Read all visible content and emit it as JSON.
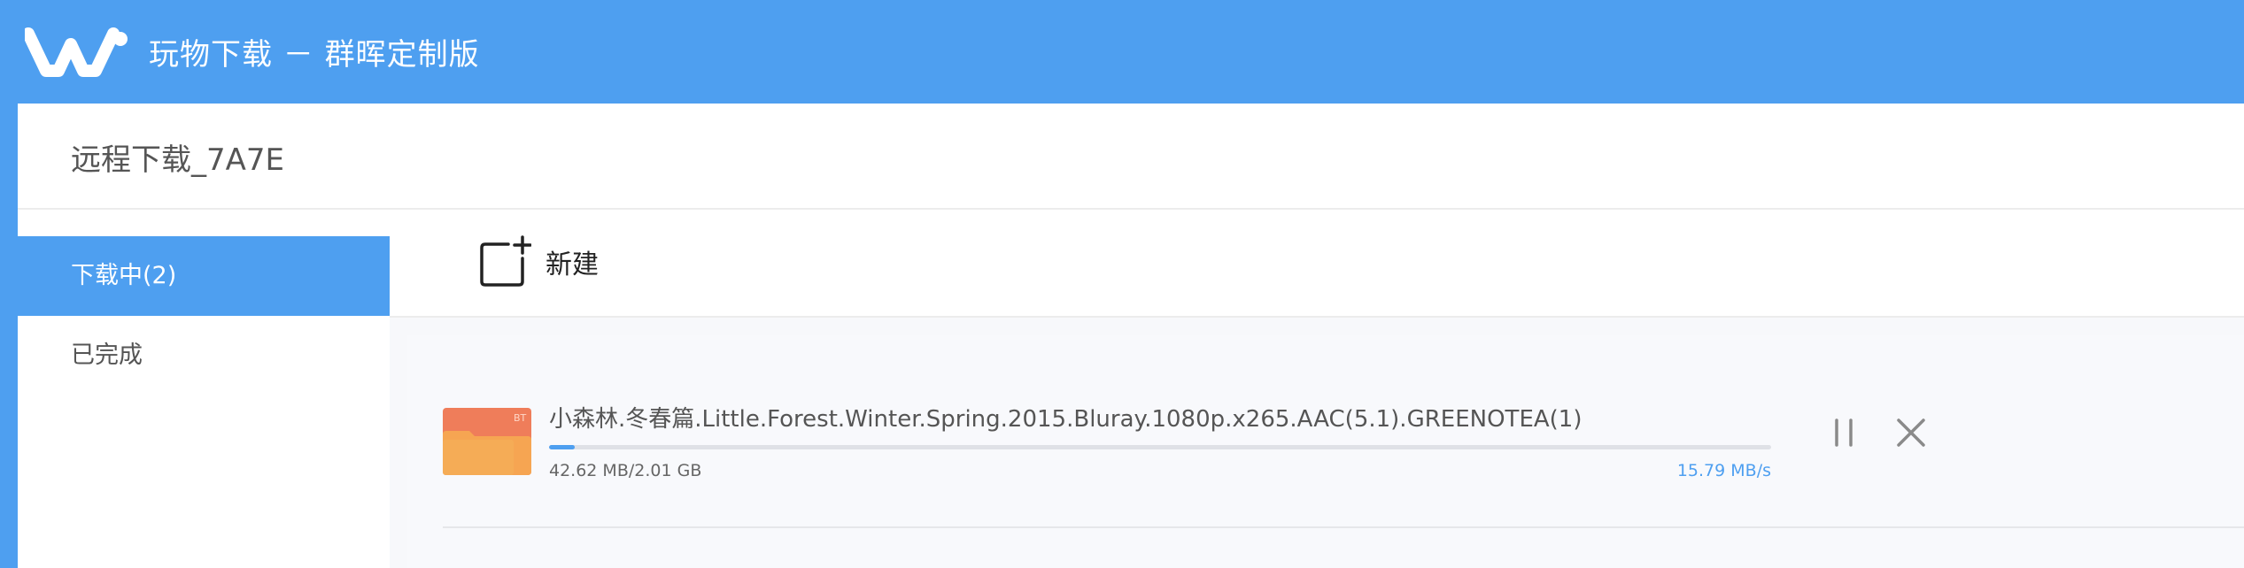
{
  "app": {
    "title": "玩物下载 － 群晖定制版"
  },
  "panel": {
    "title": "远程下载_7A7E"
  },
  "sidebar": {
    "items": [
      {
        "label": "下载中(2)",
        "active": true
      },
      {
        "label": "已完成",
        "active": false
      }
    ]
  },
  "toolbar": {
    "new_label": "新建"
  },
  "tasks": [
    {
      "name": "小森林.冬春篇.Little.Forest.Winter.Spring.2015.Bluray.1080p.x265.AAC(5.1).GREENOTEA(1)",
      "type_badge": "BT",
      "size_text": "42.62 MB/2.01 GB",
      "speed": "15.79 MB/s",
      "progress": 0.021
    }
  ],
  "icons": {
    "logo": "wanwu-logo-icon",
    "new": "new-task-plus-icon",
    "file": "bt-folder-icon",
    "pause": "pause-icon",
    "close": "close-icon"
  },
  "colors": {
    "accent": "#4e9ff0",
    "folder_back": "#ef7d5a",
    "folder_front": "#f6a552"
  }
}
